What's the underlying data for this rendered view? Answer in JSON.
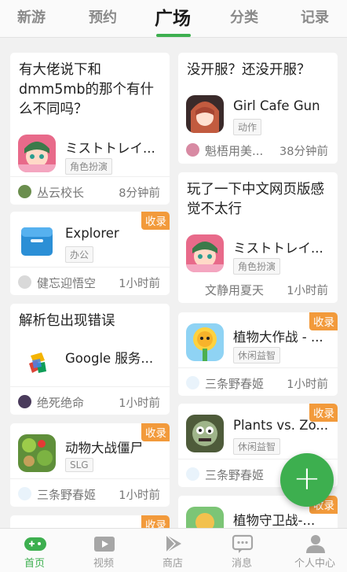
{
  "tabs": [
    {
      "label": "新游"
    },
    {
      "label": "预约"
    },
    {
      "label": "广场"
    },
    {
      "label": "分类"
    },
    {
      "label": "记录"
    }
  ],
  "active_tab": "广场",
  "left_column": [
    {
      "title": "有大佬说下和dmm5mb的那个有什么不同吗？",
      "app_name": "ミストトレイ...",
      "app_tag": "角色扮演",
      "user": "丛云校长",
      "time": "8分钟前"
    },
    {
      "badge": "收录",
      "app_name": "Explorer",
      "app_tag": "办公",
      "user": "健忘迎悟空",
      "time": "1小时前"
    },
    {
      "title": "解析包出现错误",
      "app_name": "Google 服务...",
      "user": "绝死绝命",
      "time": "1小时前"
    },
    {
      "badge": "收录",
      "app_name": "动物大战僵尸",
      "app_tag": "SLG",
      "user": "三条野春姬",
      "time": "1小时前"
    },
    {
      "badge": "收录"
    }
  ],
  "right_column": [
    {
      "title": "没开服？还没开服？",
      "app_name": "Girl Cafe Gun",
      "app_tag": "动作",
      "user": "魁梧用美...",
      "time": "38分钟前"
    },
    {
      "title": "玩了一下中文网页版感觉不太行",
      "app_name": "ミストトレイ...",
      "app_tag": "角色扮演",
      "user": "文静用夏天",
      "time": "1小时前"
    },
    {
      "badge": "收录",
      "app_name": "植物大作战 - ...",
      "app_tag": "休闲益智",
      "user": "三条野春姬",
      "time": "1小时前"
    },
    {
      "badge": "收录",
      "app_name": "Plants vs. Zo...",
      "app_tag": "休闲益智",
      "user": "三条野春姬"
    },
    {
      "badge": "收录",
      "app_name": "植物守卫战-..."
    }
  ],
  "fab": {
    "label": "+"
  },
  "bottom_nav": [
    {
      "label": "首页",
      "icon": "gamepad-icon"
    },
    {
      "label": "视频",
      "icon": "video-icon"
    },
    {
      "label": "商店",
      "icon": "store-icon"
    },
    {
      "label": "消息",
      "icon": "message-icon"
    },
    {
      "label": "个人中心",
      "icon": "person-icon"
    }
  ],
  "colors": {
    "accent": "#3daf4f",
    "badge": "#f29a3b"
  }
}
